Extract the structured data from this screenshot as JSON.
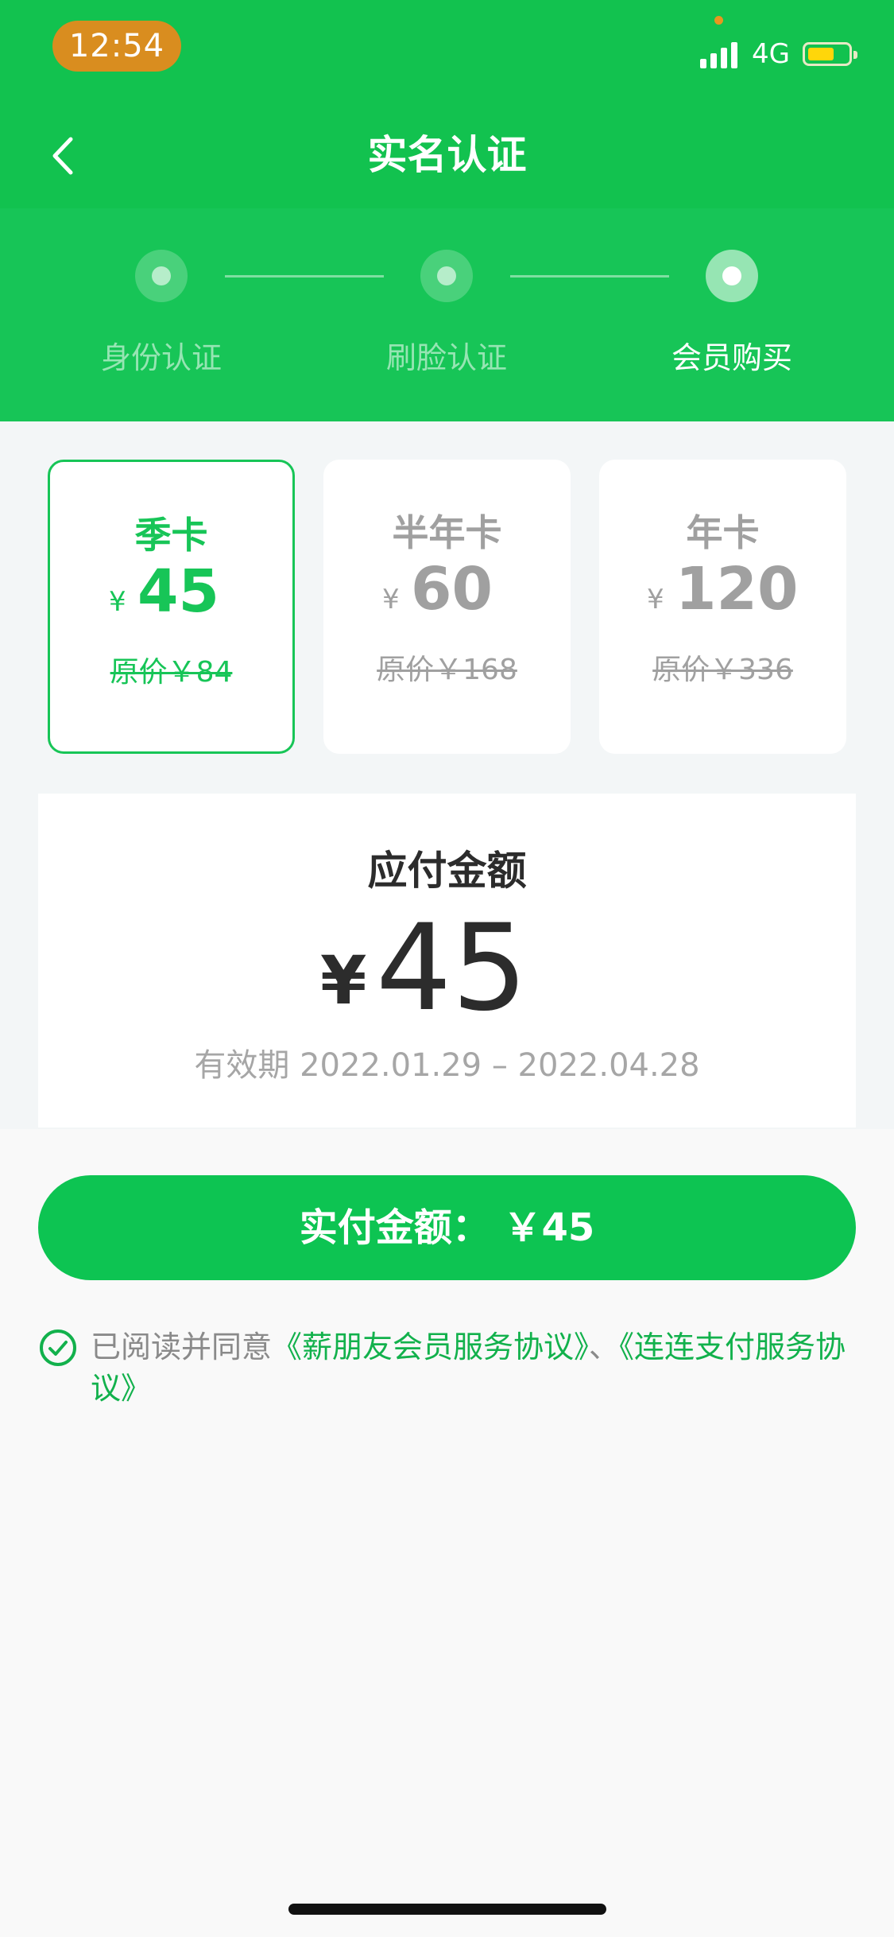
{
  "status_bar": {
    "time": "12:54",
    "network": "4G"
  },
  "nav": {
    "title": "实名认证"
  },
  "steps": [
    {
      "label": "身份认证",
      "active": false
    },
    {
      "label": "刷脸认证",
      "active": false
    },
    {
      "label": "会员购买",
      "active": true
    }
  ],
  "plans": [
    {
      "name": "季卡",
      "currency": "¥",
      "price": "45",
      "original": "原价￥84",
      "selected": true
    },
    {
      "name": "半年卡",
      "currency": "¥",
      "price": "60",
      "original": "原价￥168",
      "selected": false
    },
    {
      "name": "年卡",
      "currency": "¥",
      "price": "120",
      "original": "原价￥336",
      "selected": false
    }
  ],
  "payment": {
    "title": "应付金额",
    "currency": "¥",
    "amount": "45",
    "validity": "有效期 2022.01.29 – 2022.04.28"
  },
  "submit": {
    "label": "实付金额： ￥45"
  },
  "agreement": {
    "prefix": "已阅读并同意",
    "link1": "《薪朋友会员服务协议》",
    "separator": "、",
    "link2": "《连连支付服务协议》",
    "checked": true
  },
  "colors": {
    "brand": "#17c557",
    "button": "#0dc452",
    "time_pill": "#d98d1f",
    "battery": "#ffd60a"
  }
}
